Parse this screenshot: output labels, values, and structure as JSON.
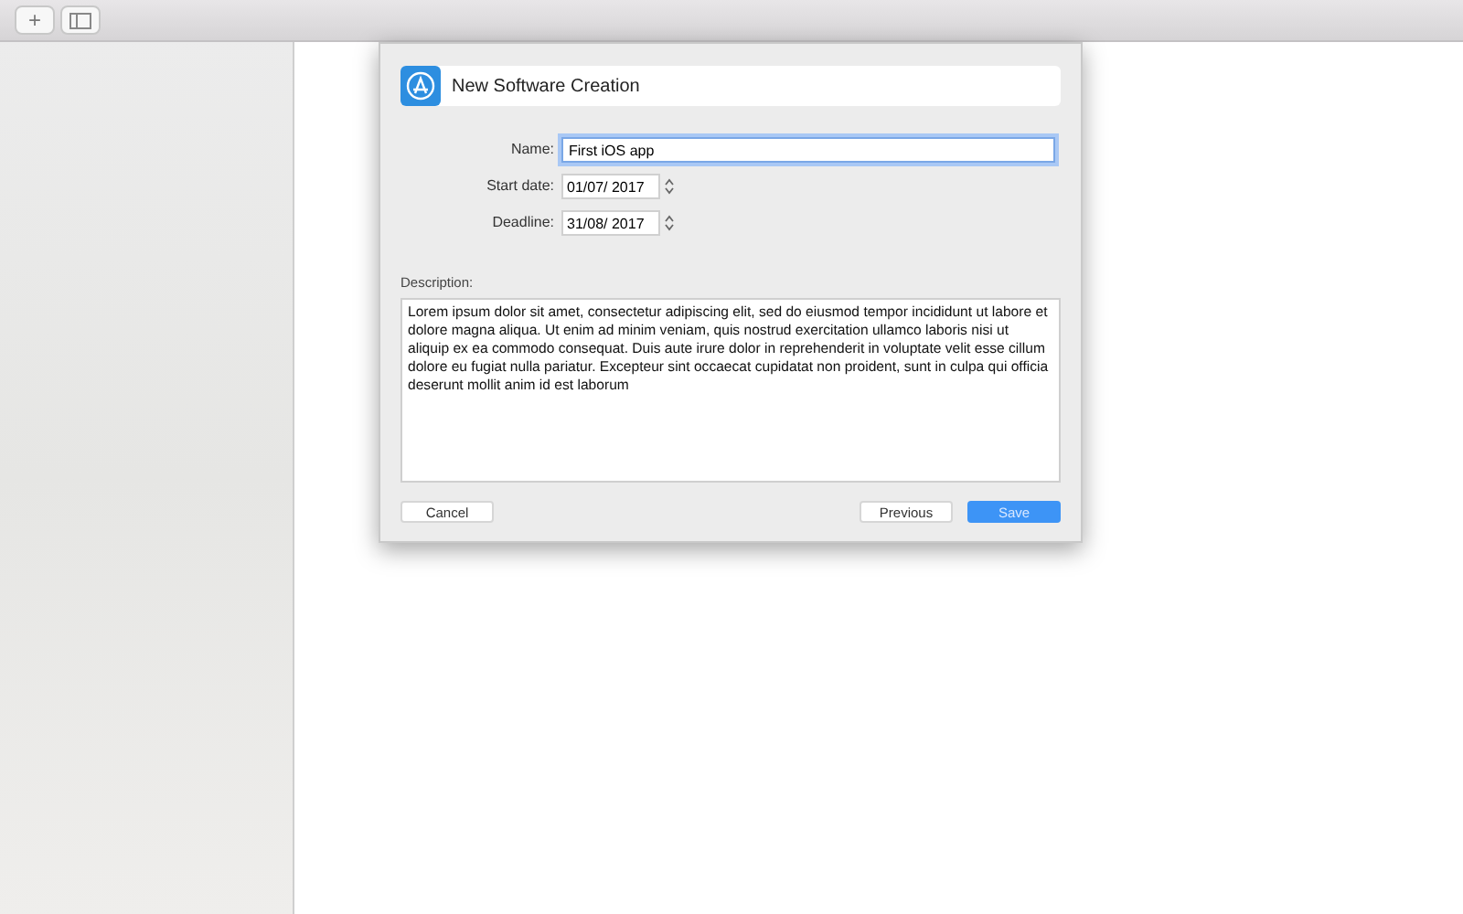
{
  "toolbar": {
    "buttons": [
      {
        "kind": "add",
        "label": "+"
      },
      {
        "kind": "sidebar"
      }
    ]
  },
  "dialog": {
    "title": "New Software Creation",
    "fields": [
      {
        "kind": "text",
        "label": "Name:",
        "value": "First iOS app",
        "focused": true
      },
      {
        "kind": "date",
        "label": "Start date:",
        "value": "01/07/ 2017",
        "focused": false
      },
      {
        "kind": "date",
        "label": "Deadline:",
        "value": "31/08/ 2017",
        "focused": false
      }
    ],
    "description": {
      "label": "Description:",
      "value": "Lorem ipsum dolor sit amet, consectetur adipiscing elit, sed do eiusmod tempor incididunt ut labore et dolore magna aliqua. Ut enim ad minim veniam, quis nostrud exercitation ullamco laboris nisi ut aliquip ex ea commodo consequat. Duis aute irure dolor in reprehenderit in voluptate velit esse cillum dolore eu fugiat nulla pariatur. Excepteur sint occaecat cupidatat non proident, sunt in culpa qui officia deserunt mollit anim id est laborum"
    },
    "buttons": [
      {
        "label": "Cancel",
        "default": false
      },
      {
        "label": "Previous",
        "default": false
      },
      {
        "label": "Save",
        "default": true
      }
    ]
  }
}
